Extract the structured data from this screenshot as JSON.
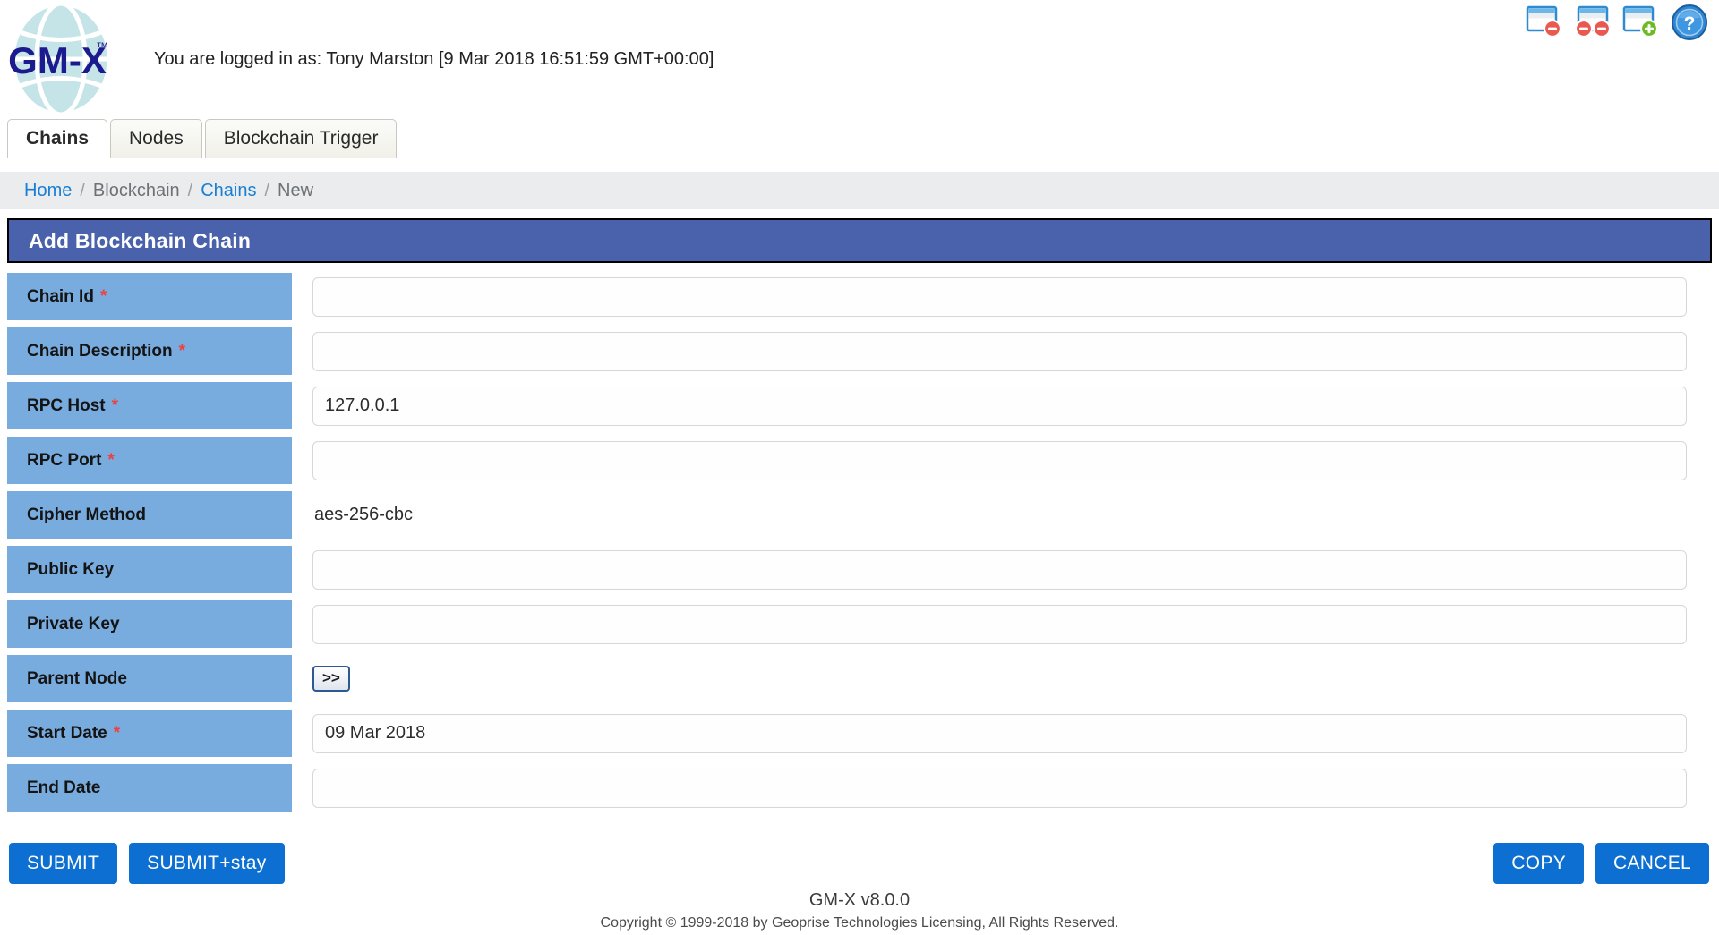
{
  "header": {
    "logo_text": "GM-X",
    "logo_tm": "™",
    "login_status": "You are logged in as: Tony Marston [9 Mar 2018 16:51:59 GMT+00:00]",
    "icons": [
      {
        "name": "close-window-icon",
        "title": "Close window"
      },
      {
        "name": "close-all-windows-icon",
        "title": "Close all windows"
      },
      {
        "name": "new-window-icon",
        "title": "New window"
      },
      {
        "name": "help-icon",
        "title": "Help"
      }
    ]
  },
  "tabs": [
    {
      "label": "Chains",
      "active": true
    },
    {
      "label": "Nodes",
      "active": false
    },
    {
      "label": "Blockchain Trigger",
      "active": false
    }
  ],
  "breadcrumb": [
    {
      "label": "Home",
      "link": true
    },
    {
      "label": "Blockchain",
      "link": false
    },
    {
      "label": "Chains",
      "link": true
    },
    {
      "label": "New",
      "link": false
    }
  ],
  "breadcrumb_separator": "/",
  "page": {
    "title": "Add Blockchain Chain"
  },
  "form": {
    "fields": [
      {
        "label": "Chain Id",
        "required": true,
        "type": "text",
        "value": ""
      },
      {
        "label": "Chain Description",
        "required": true,
        "type": "text",
        "value": ""
      },
      {
        "label": "RPC Host",
        "required": true,
        "type": "text",
        "value": "127.0.0.1"
      },
      {
        "label": "RPC Port",
        "required": true,
        "type": "text",
        "value": ""
      },
      {
        "label": "Cipher Method",
        "required": false,
        "type": "static",
        "value": "aes-256-cbc"
      },
      {
        "label": "Public Key",
        "required": false,
        "type": "text",
        "value": ""
      },
      {
        "label": "Private Key",
        "required": false,
        "type": "text",
        "value": ""
      },
      {
        "label": "Parent Node",
        "required": false,
        "type": "lookup",
        "value": ">>"
      },
      {
        "label": "Start Date",
        "required": true,
        "type": "text",
        "value": "09 Mar 2018"
      },
      {
        "label": "End Date",
        "required": false,
        "type": "text",
        "value": ""
      }
    ]
  },
  "actions": {
    "left": [
      {
        "label": "SUBMIT",
        "name": "submit-button"
      },
      {
        "label": "SUBMIT+stay",
        "name": "submit-stay-button"
      }
    ],
    "right": [
      {
        "label": "COPY",
        "name": "copy-button"
      },
      {
        "label": "CANCEL",
        "name": "cancel-button"
      }
    ]
  },
  "footer": {
    "version": "GM-X v8.0.0",
    "copyright": "Copyright © 1999-2018 by Geoprise Technologies Licensing, All Rights Reserved."
  },
  "colors": {
    "title_bar": "#4a62ab",
    "label_cell": "#79acde",
    "button": "#0d6fd1",
    "link": "#1a7fd4",
    "required_star": "#ef3f3f",
    "breadcrumb_bg": "#eaecee",
    "logo_globe": "#c5e4e8",
    "logo_text": "#1b1b8f"
  }
}
